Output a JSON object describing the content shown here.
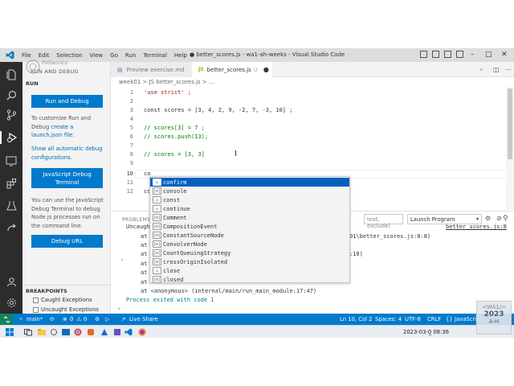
{
  "window": {
    "title": "● better_scores.js - wa1-ah-weeks - Visual Studio Code",
    "menu": [
      "File",
      "Edit",
      "Selection",
      "View",
      "Go",
      "Run",
      "Terminal",
      "Help"
    ]
  },
  "sidebar": {
    "title": "RUN AND DEBUG",
    "section": "RUN",
    "run_debug_button": "Run and Debug",
    "customize_text": "To customize Run and Debug",
    "create_link": "create a launch.json file",
    "create_suffix": ".",
    "show_link": "Show all automatic debug configurations.",
    "js_terminal_button": "JavaScript Debug Terminal",
    "terminal_text": "You can use the JavaScript Debug Terminal to debug Node.js processes run on the command line.",
    "debug_url_button": "Debug URL",
    "breakpoints_header": "BREAKPOINTS",
    "breakpoints": [
      "Caught Exceptions",
      "Uncaught Exceptions"
    ]
  },
  "tabs": [
    {
      "label": "Preview exercise.md",
      "icon": "preview-icon",
      "active": false
    },
    {
      "label": "better_scores.js",
      "prefix": "JS",
      "status": "U",
      "active": true
    }
  ],
  "breadcrumb": "week01 > JS better_scores.js > ...",
  "editor": {
    "lines": [
      {
        "n": "1",
        "text": "'use strict' ;"
      },
      {
        "n": "2",
        "text": ""
      },
      {
        "n": "3",
        "text": "const scores = [3, 4, 2, 9, -2, 7, -3, 10] ;"
      },
      {
        "n": "4",
        "text": ""
      },
      {
        "n": "5",
        "text": "// scores[3] = 7 ;"
      },
      {
        "n": "6",
        "text": "// scores.push(13);"
      },
      {
        "n": "7",
        "text": ""
      },
      {
        "n": "8",
        "text": "// scores = [3, 3]"
      },
      {
        "n": "9",
        "text": ""
      },
      {
        "n": "10",
        "text": "co"
      },
      {
        "n": "11",
        "text": ""
      },
      {
        "n": "12",
        "text": "co"
      }
    ]
  },
  "suggestions": [
    {
      "label": "confirm",
      "kind": "method",
      "selected": true
    },
    {
      "label": "console",
      "kind": "variable"
    },
    {
      "label": "const",
      "kind": "keyword"
    },
    {
      "label": "continue",
      "kind": "keyword"
    },
    {
      "label": "Comment",
      "kind": "variable"
    },
    {
      "label": "CompositionEvent",
      "kind": "variable"
    },
    {
      "label": "ConstantSourceNode",
      "kind": "variable"
    },
    {
      "label": "ConvolverNode",
      "kind": "variable"
    },
    {
      "label": "CountQueuingStrategy",
      "kind": "variable"
    },
    {
      "label": "crossOriginIsolated",
      "kind": "variable"
    },
    {
      "label": "close",
      "kind": "method"
    },
    {
      "label": "closed",
      "kind": "variable"
    }
  ],
  "panel": {
    "tab": "PROBLEMS",
    "filter_placeholder": "text, exclude)",
    "launch_select": "Launch Program",
    "output_lines": [
      "Uncaught",
      "at",
      "at",
      "at",
      "at",
      "at",
      "at",
      "at <anonymous> (internal/main/run_main_module:17:47)"
    ],
    "right_link": "better_scores.js:8",
    "path_fragment": "01\\better_scores.js:8:8)",
    "pos_fragment": ":10)",
    "exit_text": "Process exited with code 1"
  },
  "statusbar": {
    "branch": "main*",
    "problems_errors": "0",
    "problems_warnings": "0",
    "live_share": "Live Share",
    "position": "Ln 10, Col 2",
    "spaces": "Spaces: 4",
    "encoding": "UTF-8",
    "eol": "CRLF",
    "language": "JavaScript"
  },
  "taskbar": {
    "clock": "2023-03-0̲ 08:36"
  },
  "badge": {
    "line1": "<WA1/>",
    "line2": "2023",
    "line3": "A-H"
  },
  "watermark": "Politecnico",
  "colors": {
    "accent": "#007acc",
    "activity": "#2c2c2c",
    "selection": "#0060c0"
  }
}
